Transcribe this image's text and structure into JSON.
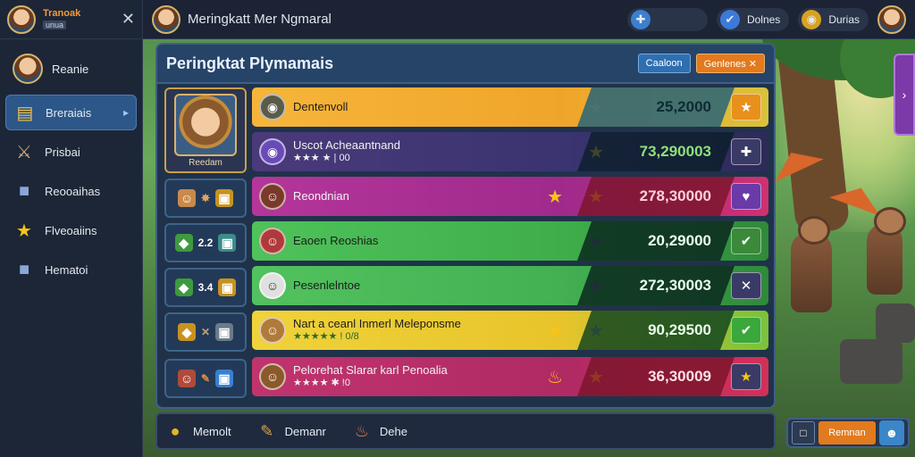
{
  "sidebar": {
    "brand_top": "Tranoak",
    "brand_sub": "unua",
    "close": "✕",
    "user_label": "Reanie",
    "items": [
      {
        "label": "Breraiais",
        "icon": "scroll-icon",
        "glyph": "▤"
      },
      {
        "label": "Prisbai",
        "icon": "crossed-swords-icon",
        "glyph": "⚔"
      },
      {
        "label": "Reooaihas",
        "icon": "cube-icon",
        "glyph": "■"
      },
      {
        "label": "Flveoaiins",
        "icon": "star-icon",
        "glyph": "★"
      },
      {
        "label": "Hematoi",
        "icon": "cube-icon",
        "glyph": "■"
      }
    ]
  },
  "topbar": {
    "title": "Meringkatt Mer Ngmaral",
    "pills": [
      {
        "label": "",
        "glyph": "✚",
        "icon": "plus-icon"
      },
      {
        "label": "Dolnes",
        "glyph": "✔",
        "icon": "check-badge-icon"
      },
      {
        "label": "Durias",
        "glyph": "◉",
        "icon": "coin-icon"
      }
    ]
  },
  "panel": {
    "title": "Peringktat Plymamais",
    "btn_blue": "Caaloon",
    "btn_orange": "Genlenes ✕",
    "top_player_name": "Reedam",
    "left_cells": [
      {
        "a": "✸",
        "b": "▣"
      },
      {
        "a": "2.2",
        "b": "▣"
      },
      {
        "a": "3.4",
        "b": "▣"
      },
      {
        "a": "✕",
        "b": "▣"
      },
      {
        "a": "✎",
        "b": "▣"
      }
    ],
    "rows": [
      {
        "name": "Dentenvoll",
        "stars": "",
        "score": "25,2000",
        "act": "★"
      },
      {
        "name": "Uscot Acheaantnand",
        "stars": "★★★ ★ | 00",
        "score": "73,290003",
        "act": "✚"
      },
      {
        "name": "Reondnian",
        "stars": "",
        "score": "278,30000",
        "act": "♥"
      },
      {
        "name": "Eaoen Reoshias",
        "stars": "",
        "score": "20,29000",
        "act": "✔"
      },
      {
        "name": "Pesenlelntoe",
        "stars": "",
        "score": "272,30003",
        "act": "✕"
      },
      {
        "name": "Nart a ceanl Inmerl Meleponsme",
        "stars": "★★★★★ ! 0/8",
        "score": "90,29500",
        "act": "✔"
      },
      {
        "name": "Pelorehat Slarar karl Penoalia",
        "stars": "★★★★ ✱ !0",
        "score": "36,30009",
        "act": "★"
      }
    ]
  },
  "bottombar": {
    "items": [
      {
        "label": "Memolt",
        "icon": "coin-icon",
        "glyph": "●"
      },
      {
        "label": "Demanr",
        "icon": "sword-icon",
        "glyph": "✎"
      },
      {
        "label": "Dehe",
        "icon": "anvil-icon",
        "glyph": "♨"
      }
    ],
    "go_label": "Remnan"
  }
}
